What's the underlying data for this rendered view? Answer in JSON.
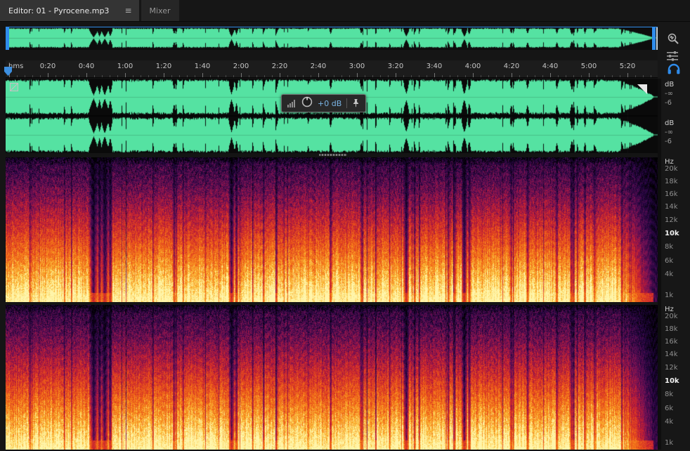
{
  "window": {
    "tabs": [
      {
        "label": "Editor: 01 - Pyrocene.mp3",
        "active": true
      },
      {
        "label": "Mixer",
        "active": false
      }
    ],
    "menu_icon": "≡"
  },
  "timeline": {
    "unit": "hms",
    "ticks": [
      "0:20",
      "0:40",
      "1:00",
      "1:20",
      "1:40",
      "2:00",
      "2:20",
      "2:40",
      "3:00",
      "3:20",
      "3:40",
      "4:00",
      "4:20",
      "4:40",
      "5:00",
      "5:20"
    ]
  },
  "hud": {
    "gain": "+0 dB"
  },
  "levels": {
    "unit": "dB",
    "values": [
      "-∞",
      "-6"
    ]
  },
  "frequency": {
    "unit": "Hz",
    "labels": [
      "20k",
      "18k",
      "16k",
      "14k",
      "12k",
      "10k",
      "8k",
      "6k",
      "4k",
      "1k"
    ],
    "highlight": "10k"
  },
  "colors": {
    "waveform_green": "#55e2a2",
    "accent_blue": "#2f8ceb",
    "hud_value_blue": "#7ab4e4"
  }
}
